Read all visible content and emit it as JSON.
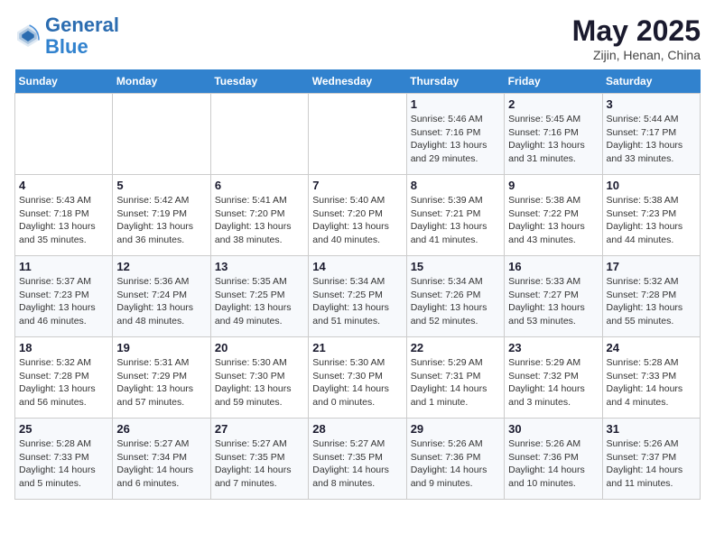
{
  "header": {
    "logo_line1": "General",
    "logo_line2": "Blue",
    "month": "May 2025",
    "location": "Zijin, Henan, China"
  },
  "weekdays": [
    "Sunday",
    "Monday",
    "Tuesday",
    "Wednesday",
    "Thursday",
    "Friday",
    "Saturday"
  ],
  "weeks": [
    [
      {
        "day": "",
        "detail": ""
      },
      {
        "day": "",
        "detail": ""
      },
      {
        "day": "",
        "detail": ""
      },
      {
        "day": "",
        "detail": ""
      },
      {
        "day": "1",
        "detail": "Sunrise: 5:46 AM\nSunset: 7:16 PM\nDaylight: 13 hours\nand 29 minutes."
      },
      {
        "day": "2",
        "detail": "Sunrise: 5:45 AM\nSunset: 7:16 PM\nDaylight: 13 hours\nand 31 minutes."
      },
      {
        "day": "3",
        "detail": "Sunrise: 5:44 AM\nSunset: 7:17 PM\nDaylight: 13 hours\nand 33 minutes."
      }
    ],
    [
      {
        "day": "4",
        "detail": "Sunrise: 5:43 AM\nSunset: 7:18 PM\nDaylight: 13 hours\nand 35 minutes."
      },
      {
        "day": "5",
        "detail": "Sunrise: 5:42 AM\nSunset: 7:19 PM\nDaylight: 13 hours\nand 36 minutes."
      },
      {
        "day": "6",
        "detail": "Sunrise: 5:41 AM\nSunset: 7:20 PM\nDaylight: 13 hours\nand 38 minutes."
      },
      {
        "day": "7",
        "detail": "Sunrise: 5:40 AM\nSunset: 7:20 PM\nDaylight: 13 hours\nand 40 minutes."
      },
      {
        "day": "8",
        "detail": "Sunrise: 5:39 AM\nSunset: 7:21 PM\nDaylight: 13 hours\nand 41 minutes."
      },
      {
        "day": "9",
        "detail": "Sunrise: 5:38 AM\nSunset: 7:22 PM\nDaylight: 13 hours\nand 43 minutes."
      },
      {
        "day": "10",
        "detail": "Sunrise: 5:38 AM\nSunset: 7:23 PM\nDaylight: 13 hours\nand 44 minutes."
      }
    ],
    [
      {
        "day": "11",
        "detail": "Sunrise: 5:37 AM\nSunset: 7:23 PM\nDaylight: 13 hours\nand 46 minutes."
      },
      {
        "day": "12",
        "detail": "Sunrise: 5:36 AM\nSunset: 7:24 PM\nDaylight: 13 hours\nand 48 minutes."
      },
      {
        "day": "13",
        "detail": "Sunrise: 5:35 AM\nSunset: 7:25 PM\nDaylight: 13 hours\nand 49 minutes."
      },
      {
        "day": "14",
        "detail": "Sunrise: 5:34 AM\nSunset: 7:25 PM\nDaylight: 13 hours\nand 51 minutes."
      },
      {
        "day": "15",
        "detail": "Sunrise: 5:34 AM\nSunset: 7:26 PM\nDaylight: 13 hours\nand 52 minutes."
      },
      {
        "day": "16",
        "detail": "Sunrise: 5:33 AM\nSunset: 7:27 PM\nDaylight: 13 hours\nand 53 minutes."
      },
      {
        "day": "17",
        "detail": "Sunrise: 5:32 AM\nSunset: 7:28 PM\nDaylight: 13 hours\nand 55 minutes."
      }
    ],
    [
      {
        "day": "18",
        "detail": "Sunrise: 5:32 AM\nSunset: 7:28 PM\nDaylight: 13 hours\nand 56 minutes."
      },
      {
        "day": "19",
        "detail": "Sunrise: 5:31 AM\nSunset: 7:29 PM\nDaylight: 13 hours\nand 57 minutes."
      },
      {
        "day": "20",
        "detail": "Sunrise: 5:30 AM\nSunset: 7:30 PM\nDaylight: 13 hours\nand 59 minutes."
      },
      {
        "day": "21",
        "detail": "Sunrise: 5:30 AM\nSunset: 7:30 PM\nDaylight: 14 hours\nand 0 minutes."
      },
      {
        "day": "22",
        "detail": "Sunrise: 5:29 AM\nSunset: 7:31 PM\nDaylight: 14 hours\nand 1 minute."
      },
      {
        "day": "23",
        "detail": "Sunrise: 5:29 AM\nSunset: 7:32 PM\nDaylight: 14 hours\nand 3 minutes."
      },
      {
        "day": "24",
        "detail": "Sunrise: 5:28 AM\nSunset: 7:33 PM\nDaylight: 14 hours\nand 4 minutes."
      }
    ],
    [
      {
        "day": "25",
        "detail": "Sunrise: 5:28 AM\nSunset: 7:33 PM\nDaylight: 14 hours\nand 5 minutes."
      },
      {
        "day": "26",
        "detail": "Sunrise: 5:27 AM\nSunset: 7:34 PM\nDaylight: 14 hours\nand 6 minutes."
      },
      {
        "day": "27",
        "detail": "Sunrise: 5:27 AM\nSunset: 7:35 PM\nDaylight: 14 hours\nand 7 minutes."
      },
      {
        "day": "28",
        "detail": "Sunrise: 5:27 AM\nSunset: 7:35 PM\nDaylight: 14 hours\nand 8 minutes."
      },
      {
        "day": "29",
        "detail": "Sunrise: 5:26 AM\nSunset: 7:36 PM\nDaylight: 14 hours\nand 9 minutes."
      },
      {
        "day": "30",
        "detail": "Sunrise: 5:26 AM\nSunset: 7:36 PM\nDaylight: 14 hours\nand 10 minutes."
      },
      {
        "day": "31",
        "detail": "Sunrise: 5:26 AM\nSunset: 7:37 PM\nDaylight: 14 hours\nand 11 minutes."
      }
    ]
  ]
}
